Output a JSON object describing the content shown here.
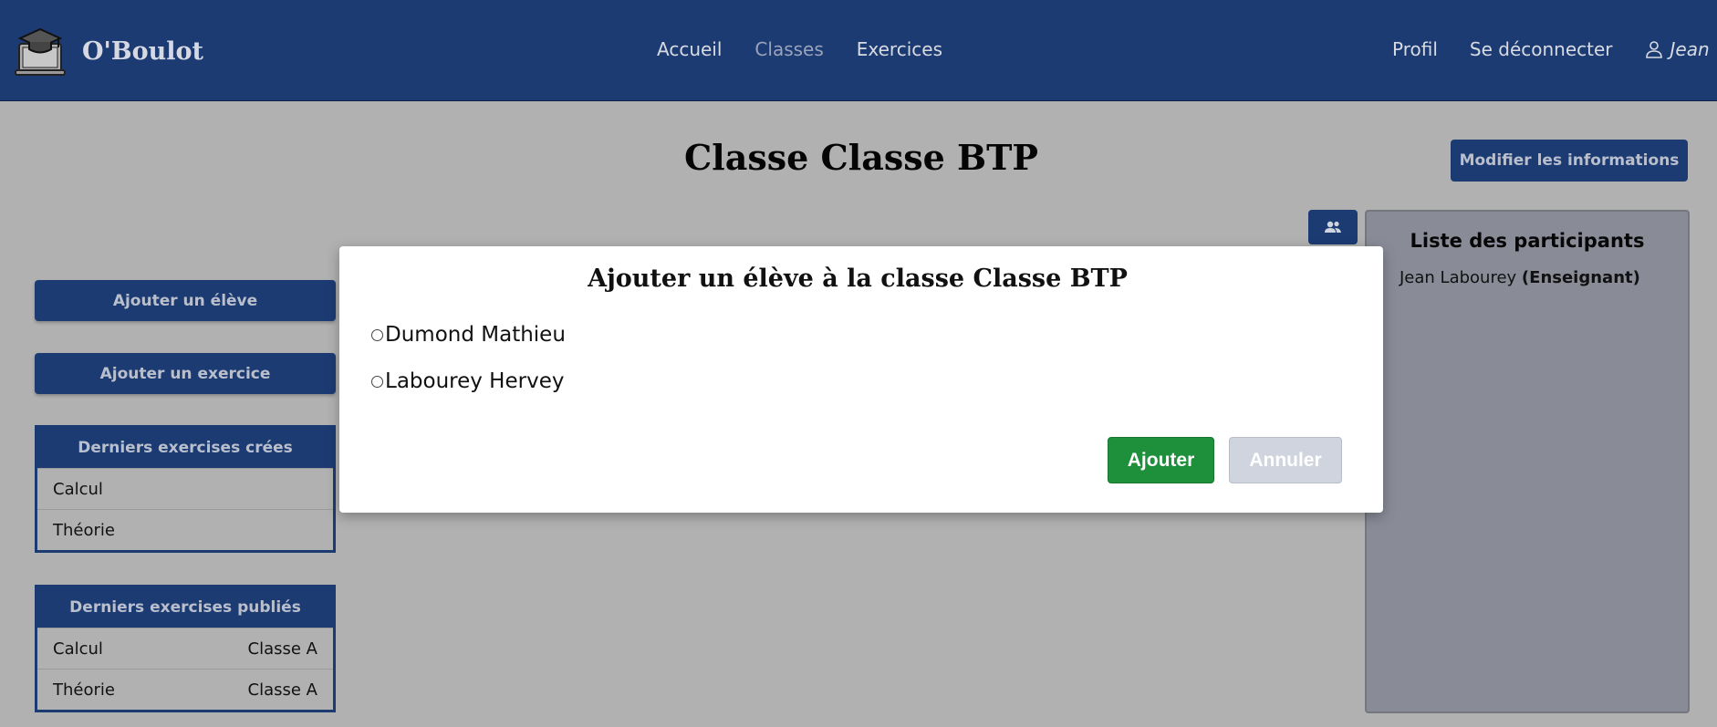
{
  "app": {
    "name": "O'Boulot"
  },
  "nav": {
    "items": [
      {
        "label": "Accueil",
        "active": false
      },
      {
        "label": "Classes",
        "active": true
      },
      {
        "label": "Exercices",
        "active": false
      }
    ],
    "profile_label": "Profil",
    "logout_label": "Se déconnecter",
    "user_name": "Jean"
  },
  "page": {
    "title": "Classe Classe BTP",
    "modify_label": "Modifier les informations"
  },
  "sidebar": {
    "add_student_label": "Ajouter un élève",
    "add_exercise_label": "Ajouter un exercice",
    "created": {
      "title": "Derniers exercises crées",
      "rows": [
        {
          "name": "Calcul",
          "class": ""
        },
        {
          "name": "Théorie",
          "class": ""
        }
      ]
    },
    "published": {
      "title": "Derniers exercises publiés",
      "rows": [
        {
          "name": "Calcul",
          "class": "Classe A"
        },
        {
          "name": "Théorie",
          "class": "Classe A"
        }
      ]
    }
  },
  "participants": {
    "title": "Liste des participants",
    "items": [
      {
        "name": "Jean Labourey",
        "role": "(Enseignant)"
      }
    ]
  },
  "modal": {
    "title": "Ajouter un élève à la classe Classe BTP",
    "options": [
      {
        "label": "Dumond Mathieu",
        "selected": false
      },
      {
        "label": "Labourey Hervey",
        "selected": false
      }
    ],
    "confirm_label": "Ajouter",
    "cancel_label": "Annuler"
  },
  "colors": {
    "navbar": "#1c3b73",
    "overlay_background": "#b1b1b1",
    "confirm": "#1e8f3b",
    "cancel": "#cfd4de"
  },
  "icons": [
    "graduation-laptop-logo-icon",
    "user-icon",
    "users-icon"
  ]
}
